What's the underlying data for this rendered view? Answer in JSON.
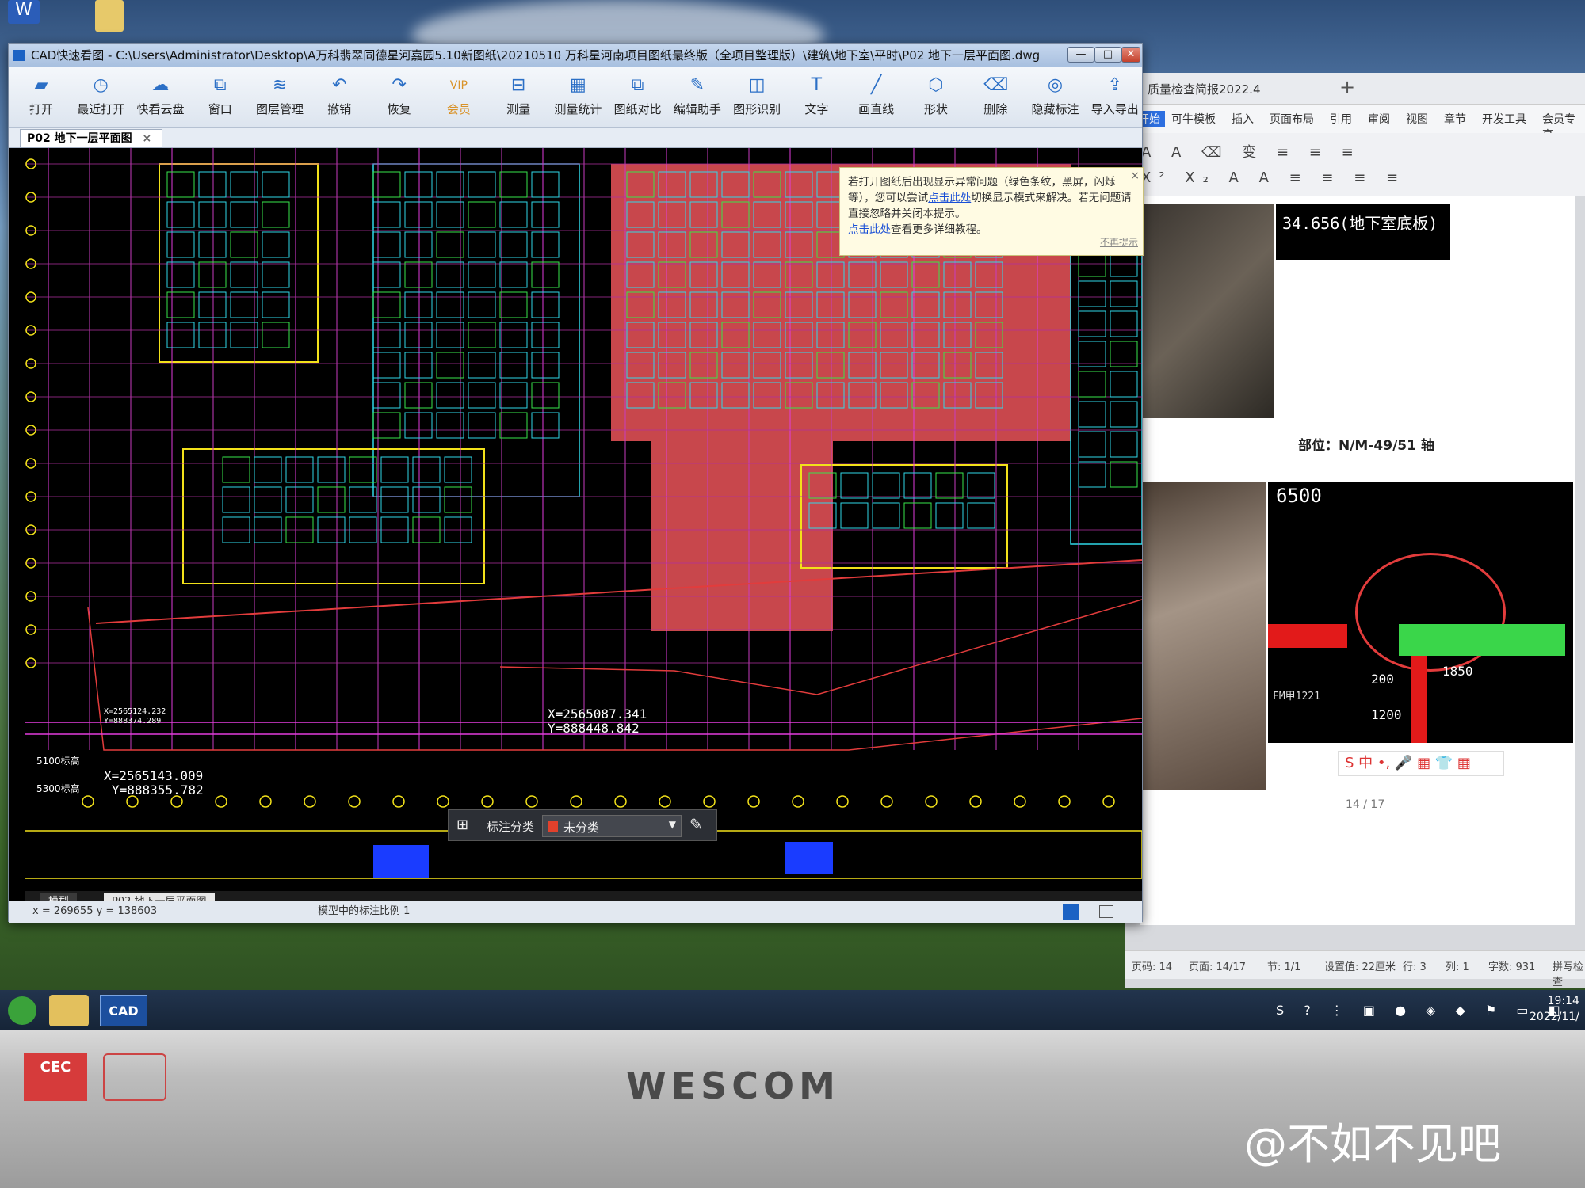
{
  "cad": {
    "title": "CAD快速看图 - C:\\Users\\Administrator\\Desktop\\A万科翡翠同德星河嘉园5.10新图纸\\20210510 万科星河南项目图纸最终版（全项目整理版）\\建筑\\地下室\\平时\\P02 地下一层平面图.dwg",
    "toolbar": [
      {
        "label": "打开",
        "icon": "folder-icon",
        "glyph": "▰"
      },
      {
        "label": "最近打开",
        "icon": "clock-icon",
        "glyph": "◷"
      },
      {
        "label": "快看云盘",
        "icon": "cloud-icon",
        "glyph": "☁"
      },
      {
        "label": "窗口",
        "icon": "window-icon",
        "glyph": "⧉"
      },
      {
        "label": "图层管理",
        "icon": "layers-icon",
        "glyph": "≋"
      },
      {
        "label": "撤销",
        "icon": "undo-icon",
        "glyph": "↶"
      },
      {
        "label": "恢复",
        "icon": "redo-icon",
        "glyph": "↷"
      },
      {
        "label": "会员",
        "icon": "vip-icon",
        "glyph": "VIP"
      },
      {
        "label": "测量",
        "icon": "measure-icon",
        "glyph": "⊟"
      },
      {
        "label": "测量统计",
        "icon": "measure-stats-icon",
        "glyph": "▦"
      },
      {
        "label": "图纸对比",
        "icon": "compare-icon",
        "glyph": "⧉"
      },
      {
        "label": "编辑助手",
        "icon": "edit-assistant-icon",
        "glyph": "✎"
      },
      {
        "label": "图形识别",
        "icon": "recognize-icon",
        "glyph": "◫"
      },
      {
        "label": "文字",
        "icon": "text-icon",
        "glyph": "T"
      },
      {
        "label": "画直线",
        "icon": "line-icon",
        "glyph": "╱"
      },
      {
        "label": "形状",
        "icon": "shape-icon",
        "glyph": "⬡"
      },
      {
        "label": "删除",
        "icon": "eraser-icon",
        "glyph": "⌫"
      },
      {
        "label": "隐藏标注",
        "icon": "hide-icon",
        "glyph": "◎"
      },
      {
        "label": "导入导出",
        "icon": "export-icon",
        "glyph": "⇪"
      }
    ],
    "tab_label": "P02 地下一层平面图",
    "notice": {
      "line1": "若打开图纸后出现显示异常问题（绿色条纹，黑屏，闪烁等），您可以尝试",
      "link1": "点击此处",
      "line2": "切换显示模式来解决。若无问题请直接忽略并关闭本提示。",
      "link2": "点击此处",
      "line3": "查看更多详细教程。",
      "dismiss": "不再提示"
    },
    "coords": [
      {
        "text": "X=2565087.341"
      },
      {
        "text": "Y=888448.842"
      },
      {
        "text": "X=2565143.009"
      },
      {
        "text": "Y=888355.782"
      },
      {
        "text": "5100标高"
      },
      {
        "text": "5300标高"
      },
      {
        "text": "Y=888374.289"
      },
      {
        "text": "X=2565124.232"
      }
    ],
    "classifier": {
      "label": "标注分类",
      "value": "未分类"
    },
    "layout_tabs": {
      "model": "模型",
      "sheet": "P02 地下一层平面图"
    },
    "status": {
      "xy": "x = 269655  y = 138603",
      "scale": "模型中的标注比例 1"
    }
  },
  "wps": {
    "tab_title": "质量检查简报2022.4",
    "ribbon": [
      "开始",
      "可牛模板",
      "插入",
      "页面布局",
      "引用",
      "审阅",
      "视图",
      "章节",
      "开发工具",
      "会员专享"
    ],
    "elevation_text": "34.656(地下室底板)",
    "location_label": "部位：N/M-49/51 轴",
    "dims": [
      "6500",
      "1850",
      "200",
      "1200",
      "FM甲1221"
    ],
    "page_indicator": "14 / 17",
    "status": [
      "页码: 14",
      "页面: 14/17",
      "节: 1/1",
      "设置值: 22厘米",
      "行: 3",
      "列: 1",
      "字数: 931",
      "拼写检查"
    ]
  },
  "taskbar": {
    "time": "19:14",
    "date": "2022/11/"
  },
  "monitor": {
    "brand": "WESCOM",
    "badge": "CEC"
  },
  "watermark": "@不如不见吧",
  "colors": {
    "drawing_bg": "#000000",
    "red_zone": "#c8474c",
    "cyan": "#2fd8e8",
    "yellow": "#f2e11a",
    "magenta": "#e23cde",
    "green": "#37e64b"
  }
}
